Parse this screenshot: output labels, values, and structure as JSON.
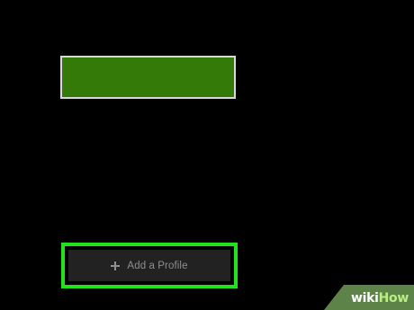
{
  "profiles": {
    "tile_color": "#347a09"
  },
  "add_profile": {
    "label": "Add a Profile",
    "icon": "plus-icon",
    "highlight_color": "#22e31a"
  },
  "watermark": {
    "part1": "wiki",
    "part2": "How"
  }
}
